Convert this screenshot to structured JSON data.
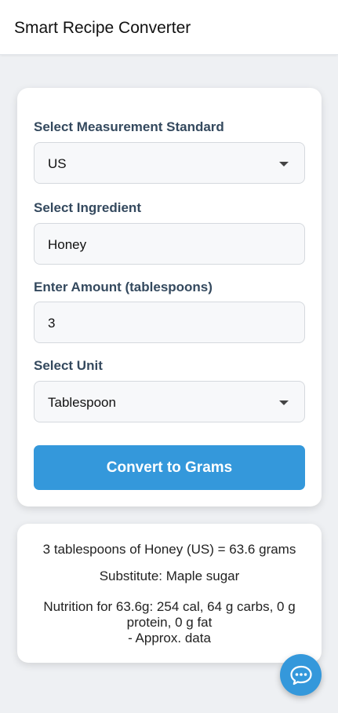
{
  "header": {
    "title": "Smart Recipe Converter"
  },
  "form": {
    "standard_label": "Select Measurement Standard",
    "standard_value": "US",
    "ingredient_label": "Select Ingredient",
    "ingredient_value": "Honey",
    "amount_label": "Enter Amount (tablespoons)",
    "amount_value": "3",
    "unit_label": "Select Unit",
    "unit_value": "Tablespoon",
    "convert_label": "Convert to Grams"
  },
  "result": {
    "conversion": "3 tablespoons of Honey (US) = 63.6 grams",
    "substitute": "Substitute: Maple sugar",
    "nutrition_line1": "Nutrition for 63.6g: 254 cal, 64 g carbs, 0 g",
    "nutrition_line2": "protein, 0 g fat",
    "nutrition_line3": "- Approx. data"
  },
  "chat": {
    "icon": "chat-bubble-icon"
  },
  "colors": {
    "accent": "#3498db",
    "label": "#34495e",
    "background": "#eef0f3"
  }
}
